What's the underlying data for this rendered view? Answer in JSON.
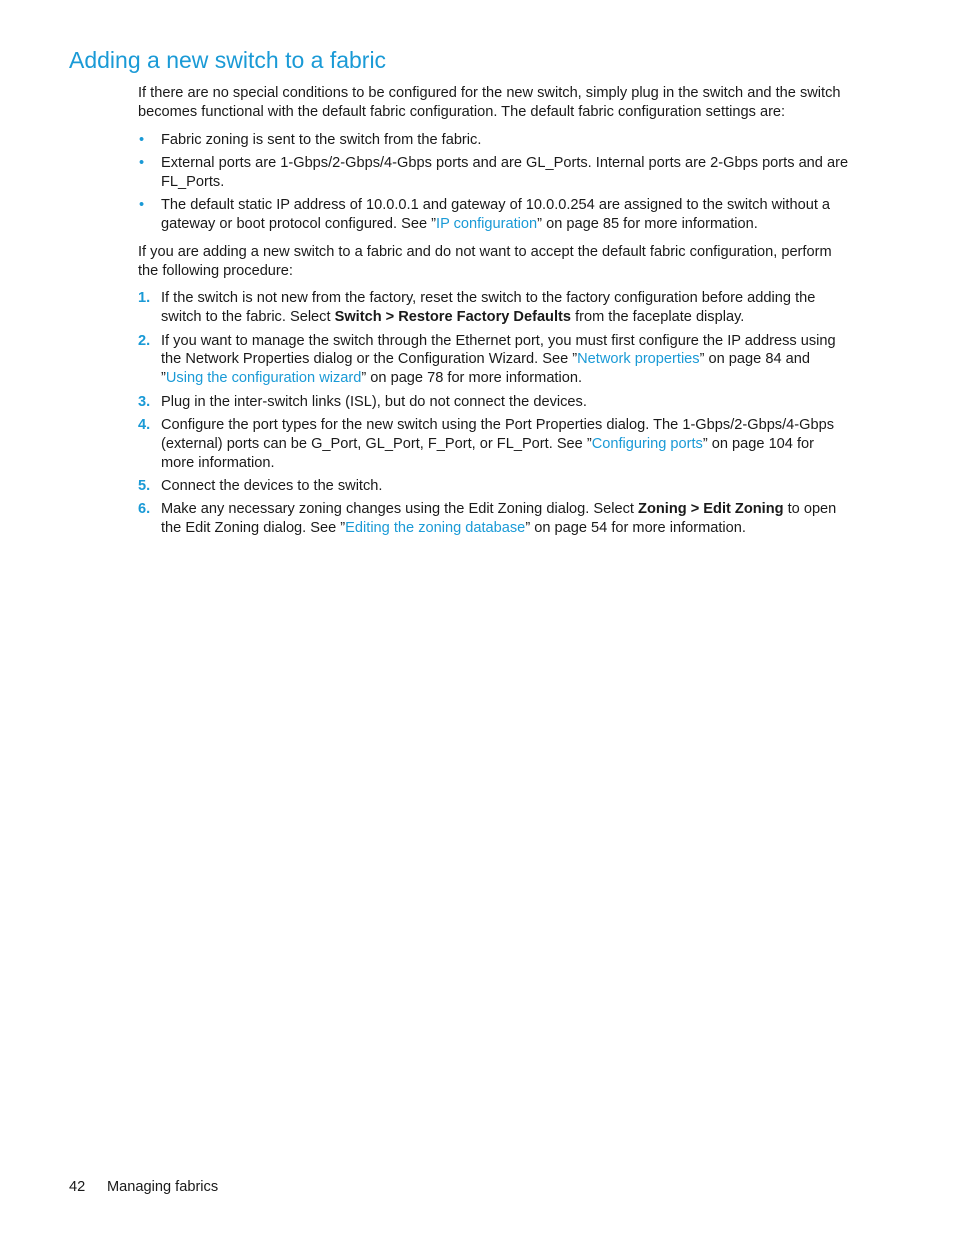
{
  "title": "Adding a new switch to a fabric",
  "intro": "If there are no special conditions to be configured for the new switch, simply plug in the switch and the switch becomes functional with the default fabric configuration. The default fabric configuration settings are:",
  "bullets": [
    {
      "text": "Fabric zoning is sent to the switch from the fabric."
    },
    {
      "text": "External ports are 1-Gbps/2-Gbps/4-Gbps ports and are GL_Ports. Internal ports are 2-Gbps ports and are FL_Ports."
    },
    {
      "pre": "The default static IP address of 10.0.0.1 and gateway of 10.0.0.254 are assigned to the switch without a gateway or boot protocol configured. See ”",
      "link": "IP configuration",
      "post": "” on page 85 for more information."
    }
  ],
  "bullet_glyph": "•",
  "procedure_intro": "If you are adding a new switch to a fabric and do not want to accept the default fabric configuration, perform the following procedure:",
  "steps": [
    {
      "num": "1.",
      "pre": "If the switch is not new from the factory, reset the switch to the factory configuration before adding the switch to the fabric. Select ",
      "bold": "Switch > Restore Factory Defaults",
      "post": " from the faceplate display."
    },
    {
      "num": "2.",
      "pre": "If you want to manage the switch through the Ethernet port, you must first configure the IP address using the Network Properties dialog or the Configuration Wizard. See ”",
      "link1": "Network properties",
      "mid": "” on page 84 and ”",
      "link2": "Using the configuration wizard",
      "post": "” on page 78 for more information."
    },
    {
      "num": "3.",
      "text": "Plug in the inter-switch links (ISL), but do not connect the devices."
    },
    {
      "num": "4.",
      "pre": "Configure the port types for the new switch using the Port Properties dialog. The 1-Gbps/2-Gbps/4-Gbps (external) ports can be G_Port, GL_Port, F_Port, or FL_Port. See ”",
      "link": "Configuring ports",
      "post": "” on page 104 for more information."
    },
    {
      "num": "5.",
      "text": "Connect the devices to the switch."
    },
    {
      "num": "6.",
      "pre": "Make any necessary zoning changes using the Edit Zoning dialog. Select ",
      "bold": "Zoning > Edit Zoning",
      "mid": " to open the Edit Zoning dialog. See ”",
      "link": "Editing the zoning database",
      "post": "” on page 54 for more information."
    }
  ],
  "footer": {
    "page_number": "42",
    "section": "Managing fabrics"
  },
  "colors": {
    "accent": "#1a9ad6",
    "text": "#1a1a1a"
  }
}
